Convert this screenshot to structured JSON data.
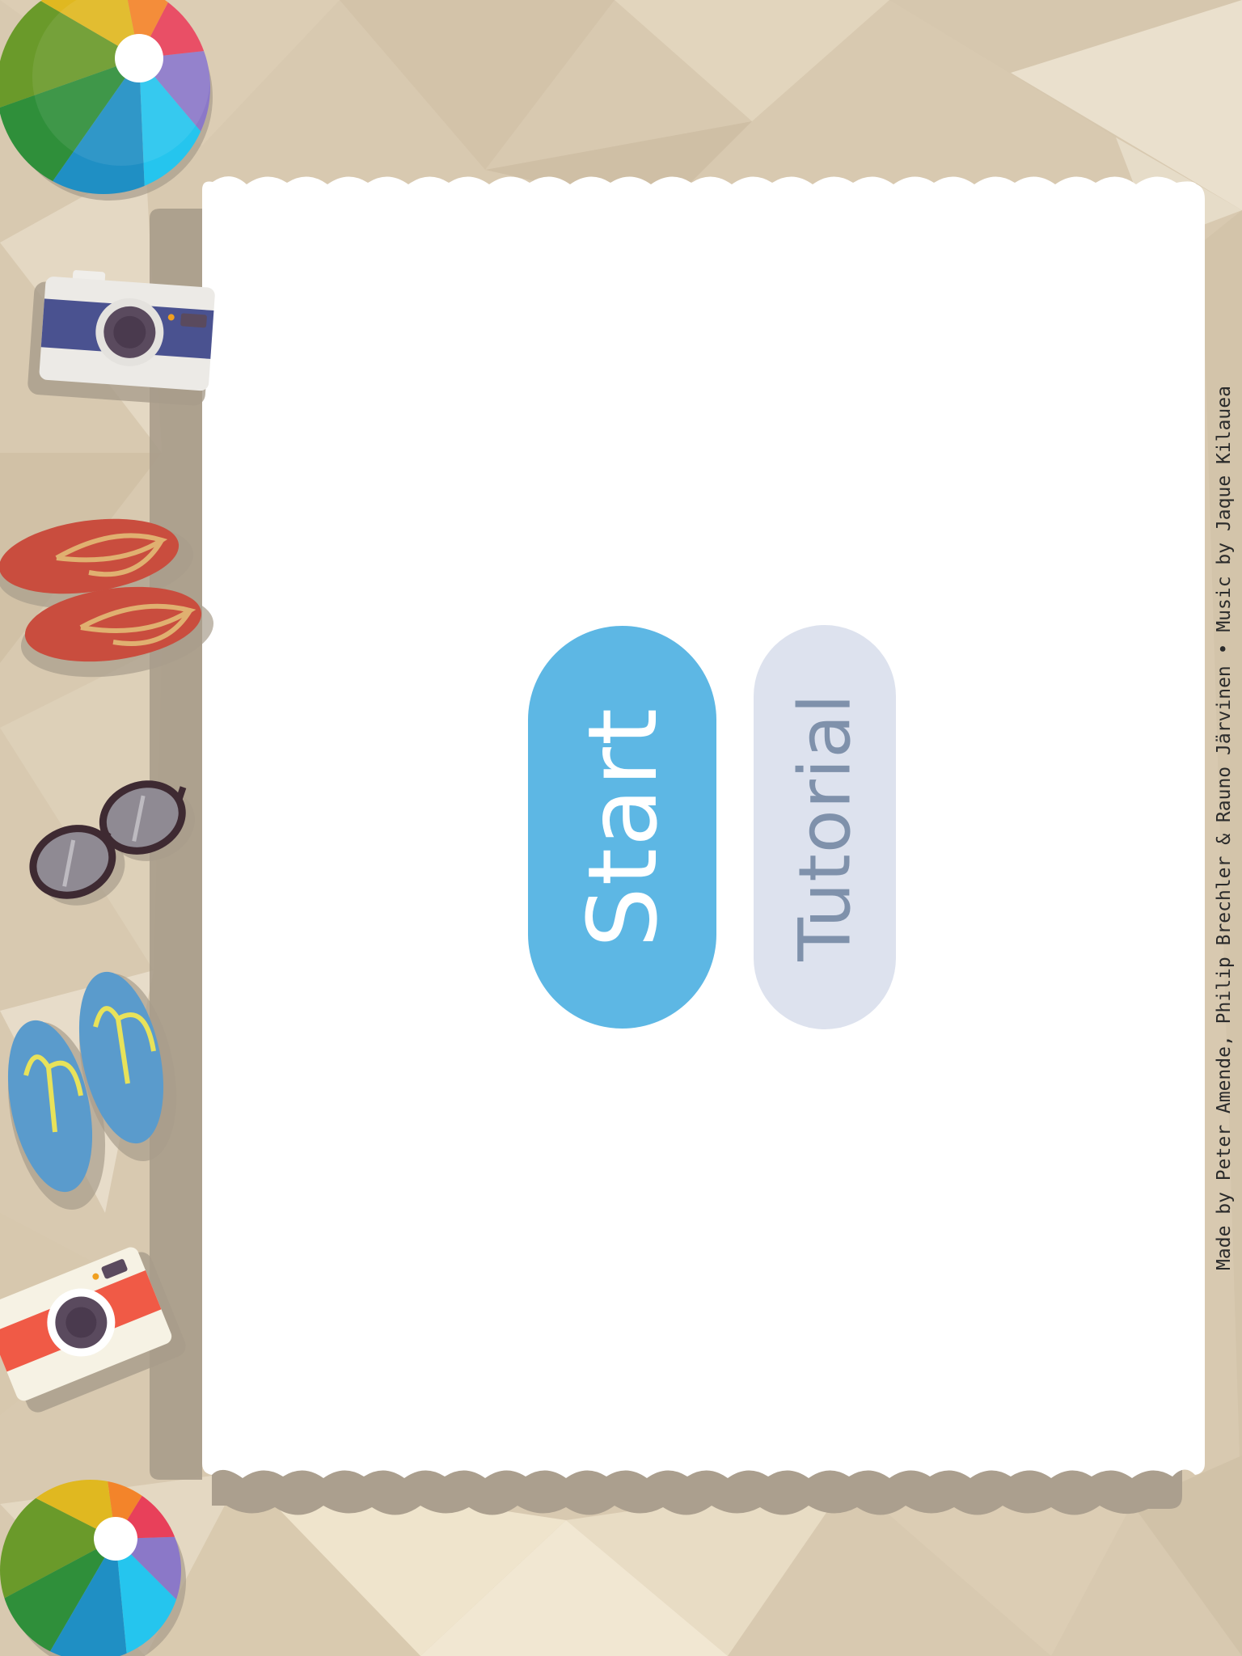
{
  "menu": {
    "start_label": "Start",
    "tutorial_label": "Tutorial"
  },
  "credits": "Made by Peter Amende, Philip Brechler & Rauno Järvinen • Music by Jaque Kilauea",
  "icons": [
    "beach-ball-icon",
    "camera-icon",
    "flip-flops-icon",
    "sunglasses-icon"
  ],
  "colors": {
    "sand": "#d9cbb2",
    "towel": "#ffffff",
    "start_button": "#5db7e4",
    "tutorial_button": "#dde2ee",
    "tutorial_text": "#7f91ab"
  }
}
